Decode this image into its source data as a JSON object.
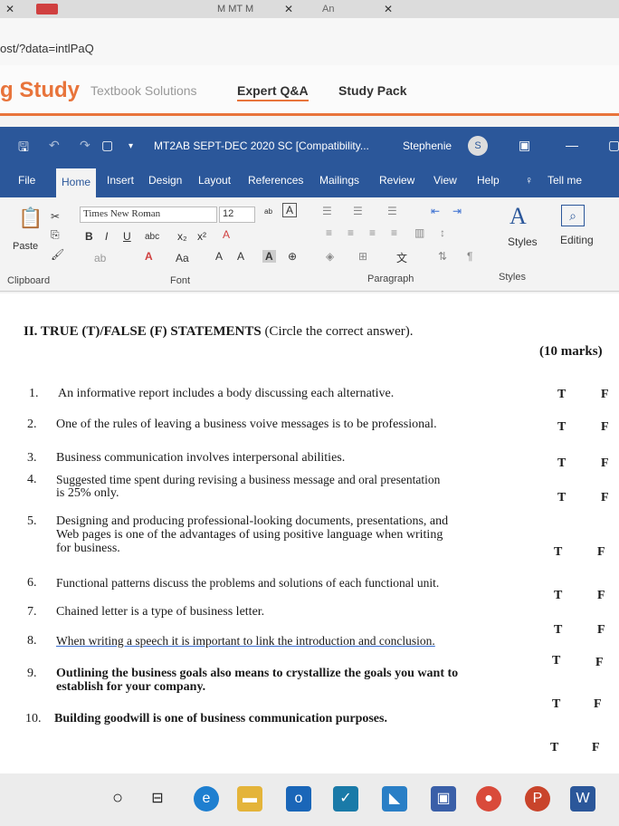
{
  "browser": {
    "tabs": [
      "M MT M",
      "An"
    ],
    "url": "ost/?data=intlPaQ"
  },
  "site_nav": {
    "logo": "g Study",
    "items": [
      "Textbook Solutions",
      "Expert Q&A",
      "Study Pack"
    ]
  },
  "word": {
    "doc_title": "MT2AB SEPT-DEC 2020 SC [Compatibility...",
    "user": "Stephenie",
    "user_initial": "S",
    "menu_tabs": [
      "File",
      "Home",
      "Insert",
      "Design",
      "Layout",
      "References",
      "Mailings",
      "Review",
      "View",
      "Help",
      "Tell me"
    ],
    "ribbon": {
      "paste": "Paste",
      "font_name": "Times New Roman",
      "font_size": "12",
      "styles": "Styles",
      "editing": "Editing",
      "group_clipboard": "Clipboard",
      "group_font": "Font",
      "group_paragraph": "Paragraph",
      "group_styles": "Styles"
    }
  },
  "document": {
    "heading_strong": "II.  TRUE (T)/FALSE (F) STATEMENTS",
    "heading_rest": " (Circle the correct answer).",
    "marks": "(10 marks)",
    "true_label": "T",
    "false_label": "F",
    "questions": [
      {
        "num": "1.",
        "lines": [
          "An informative report includes a body discussing each alternative."
        ]
      },
      {
        "num": "2.",
        "lines": [
          "One of the rules of leaving a business voive messages is to be professional."
        ]
      },
      {
        "num": "3.",
        "lines": [
          "Business communication involves interpersonal abilities."
        ]
      },
      {
        "num": "4.",
        "lines": [
          "Suggested time spent during revising a business message and oral presentation",
          "is 25% only."
        ]
      },
      {
        "num": "5.",
        "lines": [
          "Designing and producing professional-looking documents, presentations, and",
          "Web pages is one of the advantages of using positive language when writing",
          "for business."
        ]
      },
      {
        "num": "6.",
        "lines": [
          "Functional patterns discuss the problems and solutions of each functional unit."
        ]
      },
      {
        "num": "7.",
        "lines": [
          "Chained letter is a type of business letter."
        ]
      },
      {
        "num": "8.",
        "lines": [
          "When writing a speech it is important to link the introduction and conclusion."
        ]
      },
      {
        "num": "9.",
        "lines": [
          "Outlining the business goals also means to crystallize the goals you want to",
          "establish for your company."
        ]
      },
      {
        "num": "10.",
        "lines": [
          "Building goodwill is one of business communication purposes."
        ]
      }
    ]
  },
  "taskbar": {
    "icons": [
      "search-icon",
      "task-view-icon",
      "edge-icon",
      "file-explorer-icon",
      "outlook-icon",
      "mail-icon",
      "photos-icon",
      "app-icon",
      "chrome-icon",
      "powerpoint-icon",
      "word-icon"
    ]
  }
}
